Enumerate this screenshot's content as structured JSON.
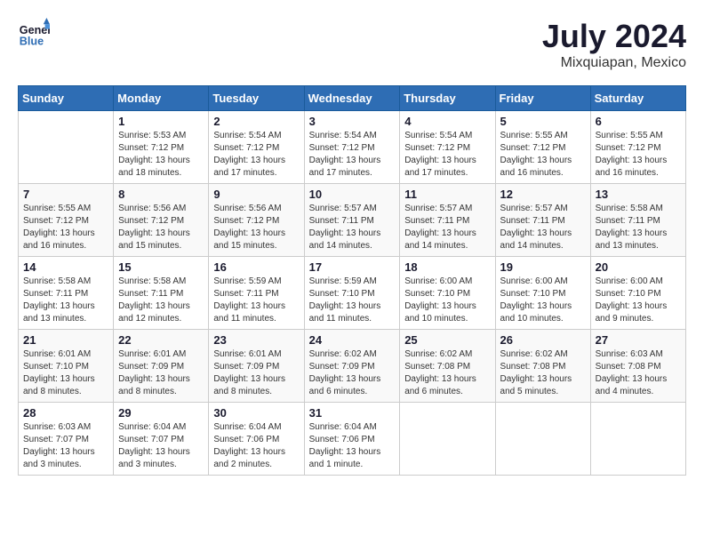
{
  "header": {
    "logo_line1": "General",
    "logo_line2": "Blue",
    "month_title": "July 2024",
    "location": "Mixquiapan, Mexico"
  },
  "weekdays": [
    "Sunday",
    "Monday",
    "Tuesday",
    "Wednesday",
    "Thursday",
    "Friday",
    "Saturday"
  ],
  "weeks": [
    [
      {
        "day": "",
        "sunrise": "",
        "sunset": "",
        "daylight": ""
      },
      {
        "day": "1",
        "sunrise": "Sunrise: 5:53 AM",
        "sunset": "Sunset: 7:12 PM",
        "daylight": "Daylight: 13 hours and 18 minutes."
      },
      {
        "day": "2",
        "sunrise": "Sunrise: 5:54 AM",
        "sunset": "Sunset: 7:12 PM",
        "daylight": "Daylight: 13 hours and 17 minutes."
      },
      {
        "day": "3",
        "sunrise": "Sunrise: 5:54 AM",
        "sunset": "Sunset: 7:12 PM",
        "daylight": "Daylight: 13 hours and 17 minutes."
      },
      {
        "day": "4",
        "sunrise": "Sunrise: 5:54 AM",
        "sunset": "Sunset: 7:12 PM",
        "daylight": "Daylight: 13 hours and 17 minutes."
      },
      {
        "day": "5",
        "sunrise": "Sunrise: 5:55 AM",
        "sunset": "Sunset: 7:12 PM",
        "daylight": "Daylight: 13 hours and 16 minutes."
      },
      {
        "day": "6",
        "sunrise": "Sunrise: 5:55 AM",
        "sunset": "Sunset: 7:12 PM",
        "daylight": "Daylight: 13 hours and 16 minutes."
      }
    ],
    [
      {
        "day": "7",
        "sunrise": "Sunrise: 5:55 AM",
        "sunset": "Sunset: 7:12 PM",
        "daylight": "Daylight: 13 hours and 16 minutes."
      },
      {
        "day": "8",
        "sunrise": "Sunrise: 5:56 AM",
        "sunset": "Sunset: 7:12 PM",
        "daylight": "Daylight: 13 hours and 15 minutes."
      },
      {
        "day": "9",
        "sunrise": "Sunrise: 5:56 AM",
        "sunset": "Sunset: 7:12 PM",
        "daylight": "Daylight: 13 hours and 15 minutes."
      },
      {
        "day": "10",
        "sunrise": "Sunrise: 5:57 AM",
        "sunset": "Sunset: 7:11 PM",
        "daylight": "Daylight: 13 hours and 14 minutes."
      },
      {
        "day": "11",
        "sunrise": "Sunrise: 5:57 AM",
        "sunset": "Sunset: 7:11 PM",
        "daylight": "Daylight: 13 hours and 14 minutes."
      },
      {
        "day": "12",
        "sunrise": "Sunrise: 5:57 AM",
        "sunset": "Sunset: 7:11 PM",
        "daylight": "Daylight: 13 hours and 14 minutes."
      },
      {
        "day": "13",
        "sunrise": "Sunrise: 5:58 AM",
        "sunset": "Sunset: 7:11 PM",
        "daylight": "Daylight: 13 hours and 13 minutes."
      }
    ],
    [
      {
        "day": "14",
        "sunrise": "Sunrise: 5:58 AM",
        "sunset": "Sunset: 7:11 PM",
        "daylight": "Daylight: 13 hours and 13 minutes."
      },
      {
        "day": "15",
        "sunrise": "Sunrise: 5:58 AM",
        "sunset": "Sunset: 7:11 PM",
        "daylight": "Daylight: 13 hours and 12 minutes."
      },
      {
        "day": "16",
        "sunrise": "Sunrise: 5:59 AM",
        "sunset": "Sunset: 7:11 PM",
        "daylight": "Daylight: 13 hours and 11 minutes."
      },
      {
        "day": "17",
        "sunrise": "Sunrise: 5:59 AM",
        "sunset": "Sunset: 7:10 PM",
        "daylight": "Daylight: 13 hours and 11 minutes."
      },
      {
        "day": "18",
        "sunrise": "Sunrise: 6:00 AM",
        "sunset": "Sunset: 7:10 PM",
        "daylight": "Daylight: 13 hours and 10 minutes."
      },
      {
        "day": "19",
        "sunrise": "Sunrise: 6:00 AM",
        "sunset": "Sunset: 7:10 PM",
        "daylight": "Daylight: 13 hours and 10 minutes."
      },
      {
        "day": "20",
        "sunrise": "Sunrise: 6:00 AM",
        "sunset": "Sunset: 7:10 PM",
        "daylight": "Daylight: 13 hours and 9 minutes."
      }
    ],
    [
      {
        "day": "21",
        "sunrise": "Sunrise: 6:01 AM",
        "sunset": "Sunset: 7:10 PM",
        "daylight": "Daylight: 13 hours and 8 minutes."
      },
      {
        "day": "22",
        "sunrise": "Sunrise: 6:01 AM",
        "sunset": "Sunset: 7:09 PM",
        "daylight": "Daylight: 13 hours and 8 minutes."
      },
      {
        "day": "23",
        "sunrise": "Sunrise: 6:01 AM",
        "sunset": "Sunset: 7:09 PM",
        "daylight": "Daylight: 13 hours and 8 minutes."
      },
      {
        "day": "24",
        "sunrise": "Sunrise: 6:02 AM",
        "sunset": "Sunset: 7:09 PM",
        "daylight": "Daylight: 13 hours and 6 minutes."
      },
      {
        "day": "25",
        "sunrise": "Sunrise: 6:02 AM",
        "sunset": "Sunset: 7:08 PM",
        "daylight": "Daylight: 13 hours and 6 minutes."
      },
      {
        "day": "26",
        "sunrise": "Sunrise: 6:02 AM",
        "sunset": "Sunset: 7:08 PM",
        "daylight": "Daylight: 13 hours and 5 minutes."
      },
      {
        "day": "27",
        "sunrise": "Sunrise: 6:03 AM",
        "sunset": "Sunset: 7:08 PM",
        "daylight": "Daylight: 13 hours and 4 minutes."
      }
    ],
    [
      {
        "day": "28",
        "sunrise": "Sunrise: 6:03 AM",
        "sunset": "Sunset: 7:07 PM",
        "daylight": "Daylight: 13 hours and 3 minutes."
      },
      {
        "day": "29",
        "sunrise": "Sunrise: 6:04 AM",
        "sunset": "Sunset: 7:07 PM",
        "daylight": "Daylight: 13 hours and 3 minutes."
      },
      {
        "day": "30",
        "sunrise": "Sunrise: 6:04 AM",
        "sunset": "Sunset: 7:06 PM",
        "daylight": "Daylight: 13 hours and 2 minutes."
      },
      {
        "day": "31",
        "sunrise": "Sunrise: 6:04 AM",
        "sunset": "Sunset: 7:06 PM",
        "daylight": "Daylight: 13 hours and 1 minute."
      },
      {
        "day": "",
        "sunrise": "",
        "sunset": "",
        "daylight": ""
      },
      {
        "day": "",
        "sunrise": "",
        "sunset": "",
        "daylight": ""
      },
      {
        "day": "",
        "sunrise": "",
        "sunset": "",
        "daylight": ""
      }
    ]
  ]
}
